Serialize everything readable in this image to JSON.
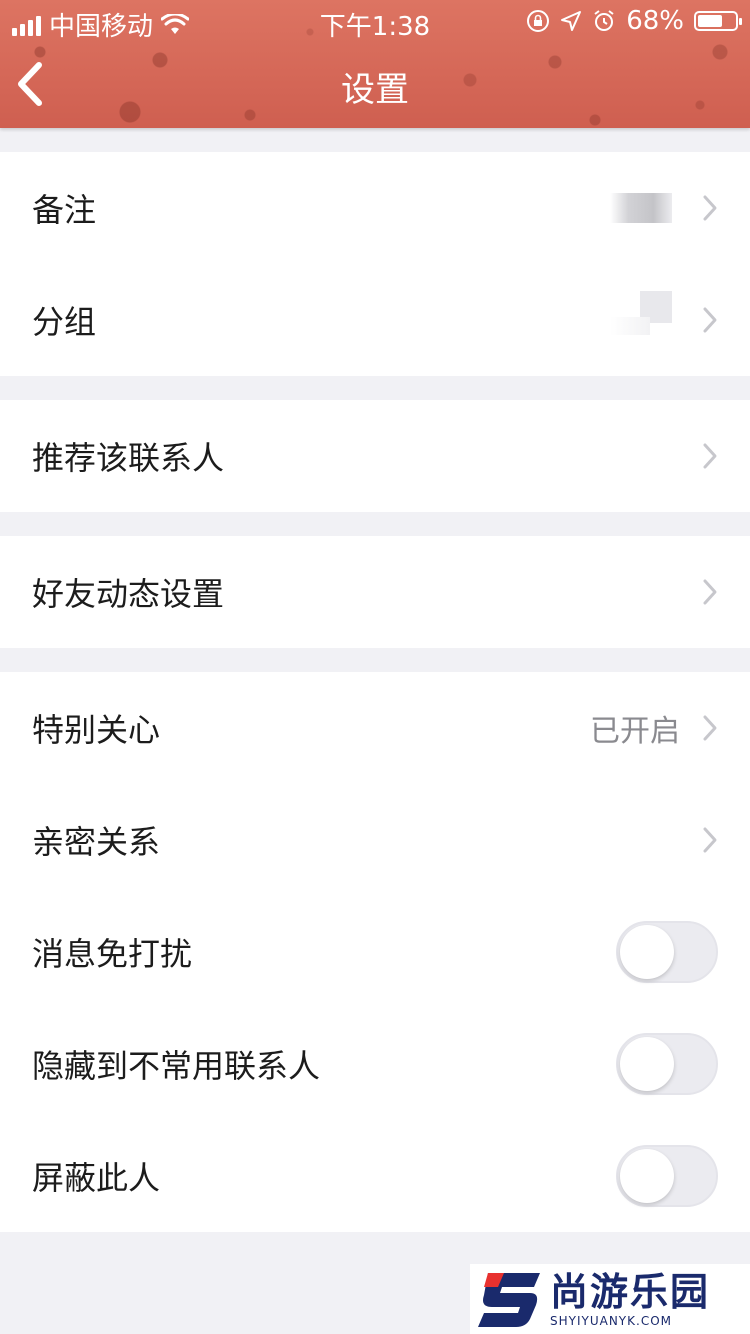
{
  "status_bar": {
    "carrier": "中国移动",
    "time": "下午1:38",
    "battery": "68%",
    "battery_level": 0.68
  },
  "nav": {
    "title": "设置",
    "back_icon": "chevron-left-icon"
  },
  "groups": [
    {
      "rows": [
        {
          "label": "备注",
          "value": "",
          "type": "arrow",
          "blurred_value": true
        },
        {
          "label": "分组",
          "value": "",
          "type": "arrow",
          "blurred_value": true
        }
      ]
    },
    {
      "rows": [
        {
          "label": "推荐该联系人",
          "value": "",
          "type": "arrow"
        }
      ]
    },
    {
      "rows": [
        {
          "label": "好友动态设置",
          "value": "",
          "type": "arrow"
        }
      ]
    },
    {
      "rows": [
        {
          "label": "特别关心",
          "value": "已开启",
          "type": "arrow"
        },
        {
          "label": "亲密关系",
          "value": "",
          "type": "arrow"
        },
        {
          "label": "消息免打扰",
          "type": "toggle",
          "on": false
        },
        {
          "label": "隐藏到不常用联系人",
          "type": "toggle",
          "on": false
        },
        {
          "label": "屏蔽此人",
          "type": "toggle",
          "on": false
        }
      ]
    }
  ],
  "watermark": {
    "text_cn": "尚游乐园",
    "text_en": "SHYIYUANYK.COM"
  },
  "colors": {
    "header": "#d86b5c",
    "background": "#f1f1f5",
    "chevron": "#c7c7cc",
    "toggle_off": "#ebebf0"
  }
}
